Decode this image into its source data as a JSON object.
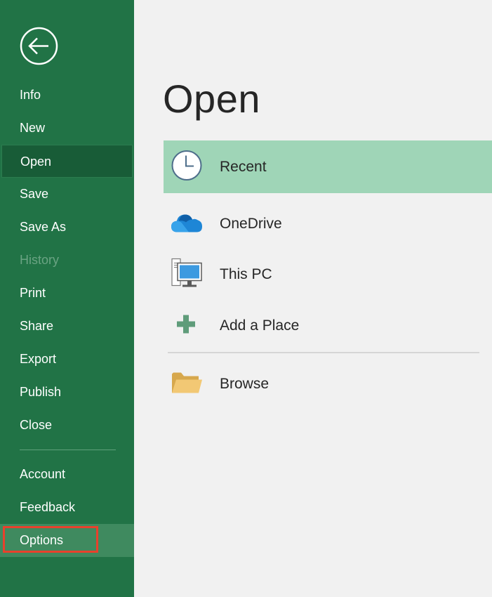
{
  "sidebar": {
    "back_icon": "back-arrow-icon",
    "items": [
      {
        "label": "Info"
      },
      {
        "label": "New"
      },
      {
        "label": "Open"
      },
      {
        "label": "Save"
      },
      {
        "label": "Save As"
      },
      {
        "label": "History"
      },
      {
        "label": "Print"
      },
      {
        "label": "Share"
      },
      {
        "label": "Export"
      },
      {
        "label": "Publish"
      },
      {
        "label": "Close"
      }
    ],
    "bottom_items": [
      {
        "label": "Account"
      },
      {
        "label": "Feedback"
      },
      {
        "label": "Options"
      }
    ],
    "active_item": "Open",
    "disabled_item": "History",
    "highlighted_item": "Options"
  },
  "main": {
    "title": "Open",
    "locations": [
      {
        "label": "Recent",
        "icon": "clock-icon",
        "selected": true
      },
      {
        "label": "OneDrive",
        "icon": "cloud-icon"
      },
      {
        "label": "This PC",
        "icon": "computer-icon"
      },
      {
        "label": "Add a Place",
        "icon": "plus-icon"
      },
      {
        "label": "Browse",
        "icon": "folder-icon"
      }
    ]
  },
  "colors": {
    "sidebar_bg": "#217346",
    "active_bg": "#185c37",
    "selected_location_bg": "#9fd5b7",
    "highlight_border": "#e8412c"
  }
}
